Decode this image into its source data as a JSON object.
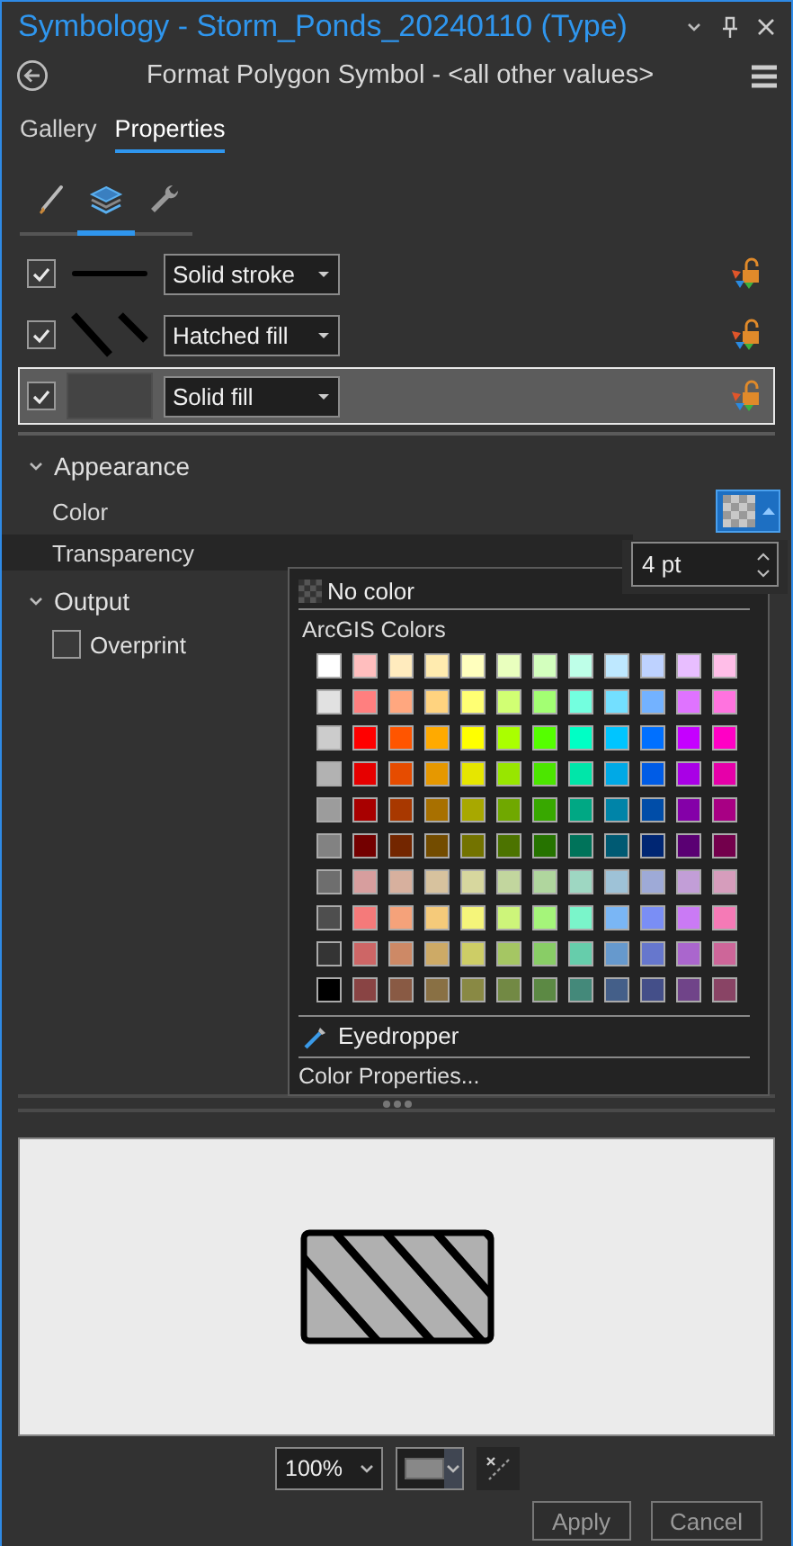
{
  "window": {
    "title": "Symbology - Storm_Ponds_20240110 (Type)"
  },
  "header": {
    "title": "Format Polygon Symbol - <all other values>"
  },
  "tabs": [
    {
      "label": "Gallery",
      "selected": false
    },
    {
      "label": "Properties",
      "selected": true
    }
  ],
  "mode_tabs": [
    {
      "kind": "brush",
      "selected": false
    },
    {
      "kind": "layers",
      "selected": true
    },
    {
      "kind": "wrench",
      "selected": false
    }
  ],
  "layers": [
    {
      "kind": "stroke",
      "label": "Solid stroke",
      "checked": true,
      "selected": false
    },
    {
      "kind": "hatch",
      "label": "Hatched fill",
      "checked": true,
      "selected": false
    },
    {
      "kind": "fill",
      "label": "Solid fill",
      "checked": true,
      "selected": true
    }
  ],
  "appearance": {
    "title": "Appearance",
    "expanded": true,
    "color_label": "Color",
    "transparency_label": "Transparency"
  },
  "output": {
    "title": "Output",
    "expanded": true,
    "overprint": {
      "label": "Overprint",
      "checked": false
    }
  },
  "width_field": {
    "value": "4 pt"
  },
  "color_popup": {
    "no_color": "No color",
    "section": "ArcGIS Colors",
    "eyedropper": "Eyedropper",
    "properties": "Color Properties...",
    "rows": [
      [
        {
          "color": "#ffffff"
        },
        {
          "color": "#ffbebe"
        },
        {
          "color": "#ffebbe"
        },
        {
          "color": "#ffebaf"
        },
        {
          "color": "#ffffbe"
        },
        {
          "color": "#e9ffbe"
        },
        {
          "color": "#d3ffbe"
        },
        {
          "color": "#beffe8"
        },
        {
          "color": "#bee8ff"
        },
        {
          "color": "#bed2ff"
        },
        {
          "color": "#e8beff"
        },
        {
          "color": "#ffbee8"
        }
      ],
      [
        {
          "color": "#e1e1e1"
        },
        {
          "color": "#ff7f7f"
        },
        {
          "color": "#ffa77f"
        },
        {
          "color": "#ffd37f"
        },
        {
          "color": "#ffff73"
        },
        {
          "color": "#d1ff73"
        },
        {
          "color": "#a3ff73"
        },
        {
          "color": "#73ffdf"
        },
        {
          "color": "#73dfff"
        },
        {
          "color": "#73b2ff"
        },
        {
          "color": "#df73ff"
        },
        {
          "color": "#ff73df"
        }
      ],
      [
        {
          "color": "#cccccc"
        },
        {
          "color": "#ff0000"
        },
        {
          "color": "#ff5500"
        },
        {
          "color": "#ffaa00"
        },
        {
          "color": "#ffff00"
        },
        {
          "color": "#aaff00"
        },
        {
          "color": "#55ff00"
        },
        {
          "color": "#00ffc5"
        },
        {
          "color": "#00c5ff"
        },
        {
          "color": "#0070ff"
        },
        {
          "color": "#c500ff"
        },
        {
          "color": "#ff00c5"
        }
      ],
      [
        {
          "color": "#b2b2b2"
        },
        {
          "color": "#e60000"
        },
        {
          "color": "#e64c00"
        },
        {
          "color": "#e69800"
        },
        {
          "color": "#e6e600"
        },
        {
          "color": "#98e600"
        },
        {
          "color": "#4ce600"
        },
        {
          "color": "#00e6a9"
        },
        {
          "color": "#00a9e6"
        },
        {
          "color": "#005ce6"
        },
        {
          "color": "#a900e6"
        },
        {
          "color": "#e600a9"
        }
      ],
      [
        {
          "color": "#9c9c9c"
        },
        {
          "color": "#a80000"
        },
        {
          "color": "#a83800"
        },
        {
          "color": "#a87000"
        },
        {
          "color": "#a8a800"
        },
        {
          "color": "#70a800"
        },
        {
          "color": "#38a800"
        },
        {
          "color": "#00a884"
        },
        {
          "color": "#0084a8"
        },
        {
          "color": "#004da8"
        },
        {
          "color": "#8400a8"
        },
        {
          "color": "#a80084"
        }
      ],
      [
        {
          "color": "#828282"
        },
        {
          "color": "#730000"
        },
        {
          "color": "#732600"
        },
        {
          "color": "#734c00"
        },
        {
          "color": "#737300"
        },
        {
          "color": "#4c7300"
        },
        {
          "color": "#267300"
        },
        {
          "color": "#00735a"
        },
        {
          "color": "#005a73"
        },
        {
          "color": "#002673"
        },
        {
          "color": "#5a0073"
        },
        {
          "color": "#73004c"
        }
      ],
      [
        {
          "color": "#6e6e6e"
        },
        {
          "color": "#d79e9e"
        },
        {
          "color": "#d7b09e"
        },
        {
          "color": "#d7c29e"
        },
        {
          "color": "#d7d79e"
        },
        {
          "color": "#c2d69e"
        },
        {
          "color": "#b0d69e"
        },
        {
          "color": "#9ed7c2"
        },
        {
          "color": "#9ec2d7"
        },
        {
          "color": "#9eaad7"
        },
        {
          "color": "#c29ed7"
        },
        {
          "color": "#d69dbc"
        }
      ],
      [
        {
          "color": "#4e4e4e"
        },
        {
          "color": "#f57a7a"
        },
        {
          "color": "#f5a27a"
        },
        {
          "color": "#f5ca7a"
        },
        {
          "color": "#f5f57a"
        },
        {
          "color": "#cdf57a"
        },
        {
          "color": "#a5f57a"
        },
        {
          "color": "#7af5ca"
        },
        {
          "color": "#7ab6f5"
        },
        {
          "color": "#7a8ef5"
        },
        {
          "color": "#ca7af5"
        },
        {
          "color": "#f57ab6"
        }
      ],
      [
        {
          "color": "#343434"
        },
        {
          "color": "#cd6666"
        },
        {
          "color": "#cd8966"
        },
        {
          "color": "#cdaa66"
        },
        {
          "color": "#cdcd66"
        },
        {
          "color": "#a5c663"
        },
        {
          "color": "#89cd66"
        },
        {
          "color": "#66cdab"
        },
        {
          "color": "#6699cd"
        },
        {
          "color": "#6677cd"
        },
        {
          "color": "#aa66cd"
        },
        {
          "color": "#cd6699"
        }
      ],
      [
        {
          "color": "#000000"
        },
        {
          "color": "#894444"
        },
        {
          "color": "#895a44"
        },
        {
          "color": "#897044"
        },
        {
          "color": "#898944"
        },
        {
          "color": "#728944"
        },
        {
          "color": "#5c8944"
        },
        {
          "color": "#44897a"
        },
        {
          "color": "#445f89"
        },
        {
          "color": "#444f89"
        },
        {
          "color": "#704489"
        },
        {
          "color": "#894465"
        }
      ]
    ]
  },
  "preview": {
    "zoom": "100%"
  },
  "buttons": [
    {
      "label": "Apply"
    },
    {
      "label": "Cancel"
    }
  ]
}
